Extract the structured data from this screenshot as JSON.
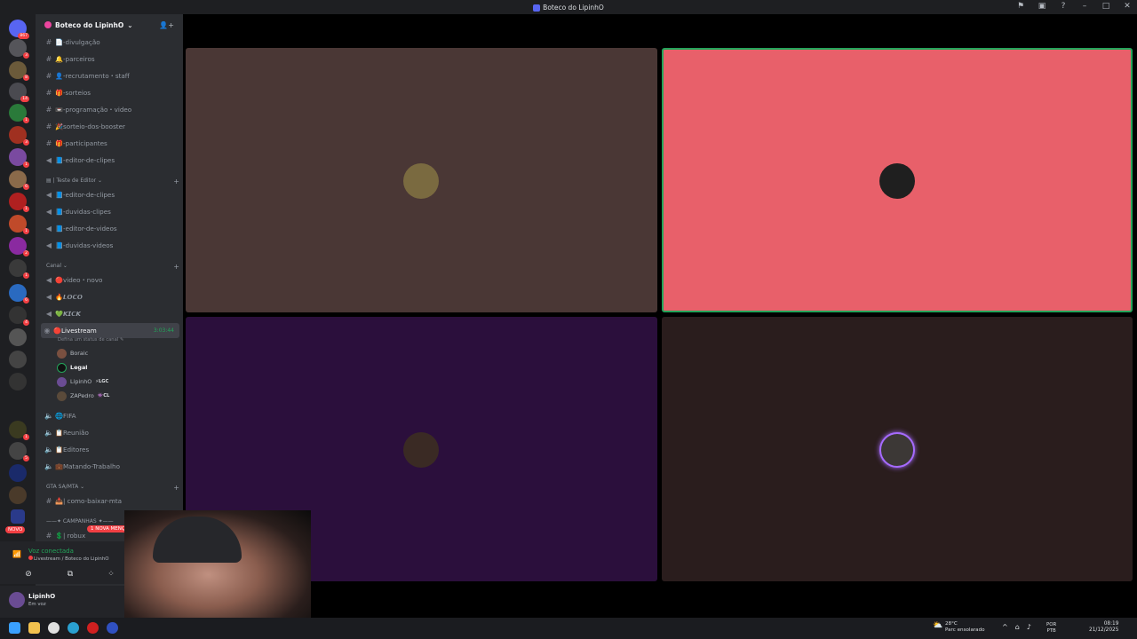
{
  "window": {
    "title": "Boteco do LipinhO"
  },
  "server": {
    "name": "Boteco do LipinhO",
    "chevron": "⌄"
  },
  "channels": [
    {
      "icon": "#",
      "name": "📄-divulgação"
    },
    {
      "icon": "#",
      "name": "🔔-parceiros"
    },
    {
      "icon": "#",
      "name": "👤-recrutamento・staff"
    },
    {
      "icon": "#",
      "name": "🎁-sorteios"
    },
    {
      "icon": "#",
      "name": "📼-programação・video"
    },
    {
      "icon": "#",
      "name": "🎉sorteio-dos-booster"
    },
    {
      "icon": "#",
      "name": "🎁-participantes"
    },
    {
      "icon": "📢",
      "name": "📘-editor-de-clipes"
    }
  ],
  "categories": {
    "teste": "| Teste de Editor ⌄",
    "canal": "Canal ⌄",
    "gta": "GTA SA/MTA ⌄",
    "campanhas": "——✦ CAMPANHAS ✦——"
  },
  "teste_channels": [
    {
      "name": "📘-editor-de-clipes"
    },
    {
      "name": "📘-duvidas-clipes"
    },
    {
      "name": "📘-editor-de-videos"
    },
    {
      "name": "📘-duvidas-videos"
    }
  ],
  "canal_channels": [
    {
      "name": "🔴video・novo"
    },
    {
      "name": "🔥𝙇𝙊𝘾𝙊"
    },
    {
      "name": "💚𝙆𝙄𝘾𝙆"
    }
  ],
  "livestream": {
    "name": "🔴Livestream",
    "timer": "3:03:44",
    "status": "Defina um status de canal ✎",
    "users": [
      {
        "name": "Boraic",
        "tag": ""
      },
      {
        "name": "Legal",
        "tag": ""
      },
      {
        "name": "LipinhO",
        "tag": "⚡LGC"
      },
      {
        "name": "ZAPedro",
        "tag": "👾CL"
      }
    ]
  },
  "other_voice": [
    {
      "name": "🌐FIFA"
    },
    {
      "name": "📋Reunião"
    },
    {
      "name": "📋Editores"
    },
    {
      "name": "💼Matando-Trabalho"
    }
  ],
  "gta_channels": [
    {
      "name": "📥| como-baixar-mta"
    }
  ],
  "campanhas_channels": [
    {
      "name": "💲| robux"
    }
  ],
  "new_mention": "1 NOVA MENÇÃO",
  "novo_badge": "NOVO",
  "guild_badges": [
    "867",
    "3",
    "8",
    "14",
    "1",
    "3",
    "1",
    "6",
    "1",
    "1",
    "2",
    "1",
    "6",
    "4",
    "1",
    "5",
    "1",
    "1",
    "1"
  ],
  "voice": {
    "status": "Voz conectada",
    "location": "Livestream / Boteco do LipinhO"
  },
  "user": {
    "name": "LipinhO",
    "status": "Em voz"
  },
  "tiles": [
    {
      "bg": "#4a3735",
      "avatar": "#7a6a40"
    },
    {
      "bg": "#e8606a",
      "avatar": "#1f1f1f"
    },
    {
      "bg": "#2b0f3c",
      "avatar": "#3a2a24"
    },
    {
      "bg": "#2a1d1d",
      "avatar": "#3c3836"
    }
  ],
  "taskbar": {
    "weather_temp": "28°C",
    "weather_desc": "Parc ensolarado",
    "lang": "POR",
    "lang2": "PTB",
    "time": "08:19",
    "date": "21/12/2025"
  }
}
